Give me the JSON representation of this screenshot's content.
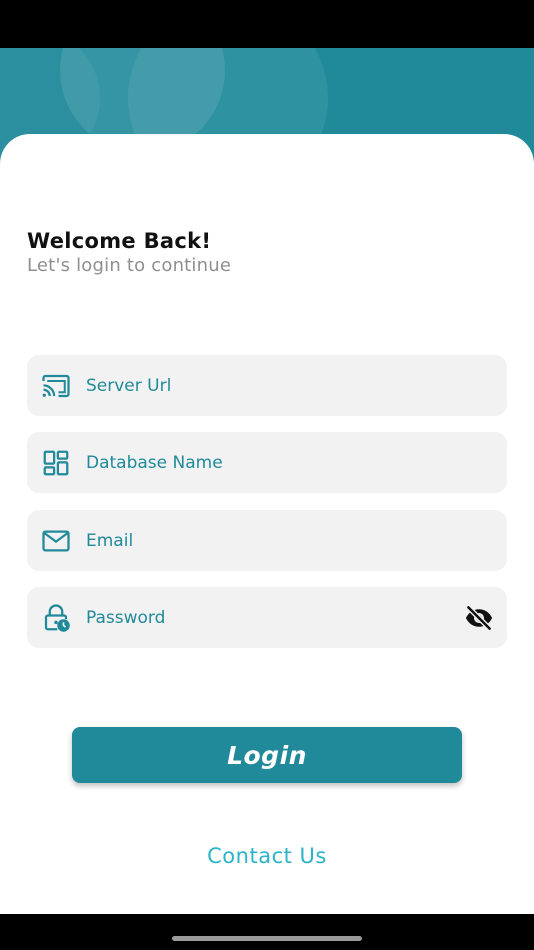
{
  "welcome": {
    "title": "Welcome Back!",
    "subtitle": "Let's login to continue"
  },
  "form": {
    "server_url": {
      "placeholder": "Server Url",
      "value": "",
      "icon": "cast-icon"
    },
    "database_name": {
      "placeholder": "Database Name",
      "value": "",
      "icon": "dashboard-grid-icon"
    },
    "email": {
      "placeholder": "Email",
      "value": "",
      "icon": "mail-icon"
    },
    "password": {
      "placeholder": "Password",
      "value": "",
      "icon": "lock-clock-icon",
      "toggle_icon": "eye-off-icon"
    }
  },
  "actions": {
    "login_label": "Login",
    "contact_label": "Contact Us"
  },
  "colors": {
    "primary": "#208a9a",
    "link": "#2ab3c9",
    "field_bg": "#f2f2f2",
    "subtitle": "#8f8f8f"
  }
}
